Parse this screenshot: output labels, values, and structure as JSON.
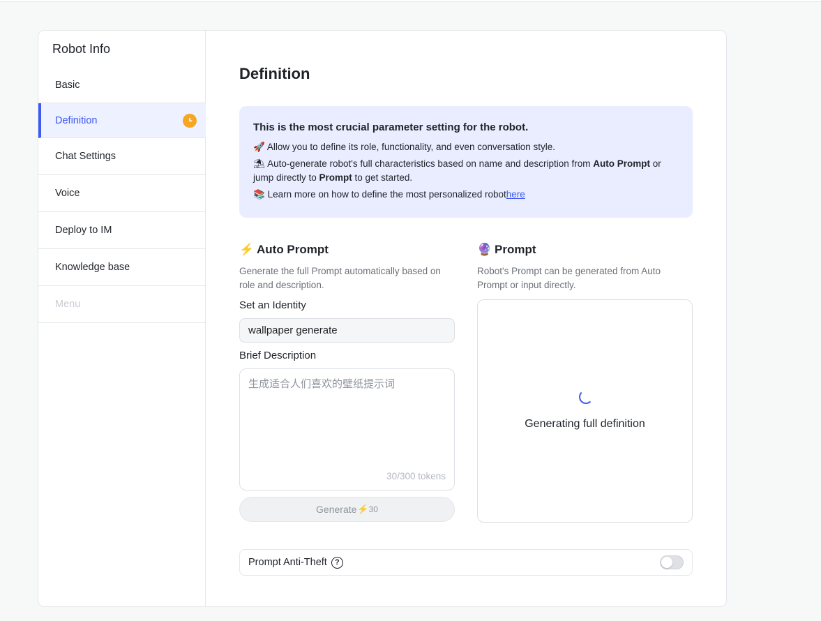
{
  "sidebar": {
    "title": "Robot Info",
    "items": [
      {
        "label": "Basic"
      },
      {
        "label": "Definition"
      },
      {
        "label": "Chat Settings"
      },
      {
        "label": "Voice"
      },
      {
        "label": "Deploy to IM"
      },
      {
        "label": "Knowledge base"
      },
      {
        "label": "Menu"
      }
    ],
    "active_item": "Definition",
    "disabled_item": "Menu",
    "badge_icon": "clock-icon"
  },
  "main": {
    "title": "Definition",
    "info": {
      "heading": "This is the most crucial parameter setting for the robot.",
      "line1_icon": "🚀",
      "line1": "Allow you to define its role, functionality, and even conversation style.",
      "line2_icon": "⛱",
      "line2_a": "Auto-generate robot's full characteristics based on name and description from ",
      "line2_b": "Auto Prompt",
      "line2_c": " or jump directly to ",
      "line2_d": "Prompt",
      "line2_e": " to get started.",
      "line3_icon": "📚",
      "line3": "Learn more on how to define the most personalized robot",
      "line3_link": "here"
    },
    "auto_prompt": {
      "icon": "⚡",
      "title": "Auto Prompt",
      "description": "Generate the full Prompt automatically based on role and description.",
      "identity_label": "Set an Identity",
      "identity_value": "wallpaper generate",
      "description_label": "Brief Description",
      "description_value": "生成适合人们喜欢的壁纸提示词",
      "token_count": "30/300 tokens",
      "generate_label": "Generate",
      "generate_cost_icon": "⚡",
      "generate_cost": "30"
    },
    "prompt": {
      "icon": "🔮",
      "title": "Prompt",
      "description": "Robot's Prompt can be generated from Auto Prompt or input directly.",
      "status": "Generating full definition"
    },
    "anti_theft": {
      "label": "Prompt Anti-Theft",
      "help_icon": "?",
      "enabled": false
    }
  },
  "colors": {
    "accent": "#3d5af1",
    "info_bg": "#eaedff",
    "badge": "#f5a623"
  }
}
